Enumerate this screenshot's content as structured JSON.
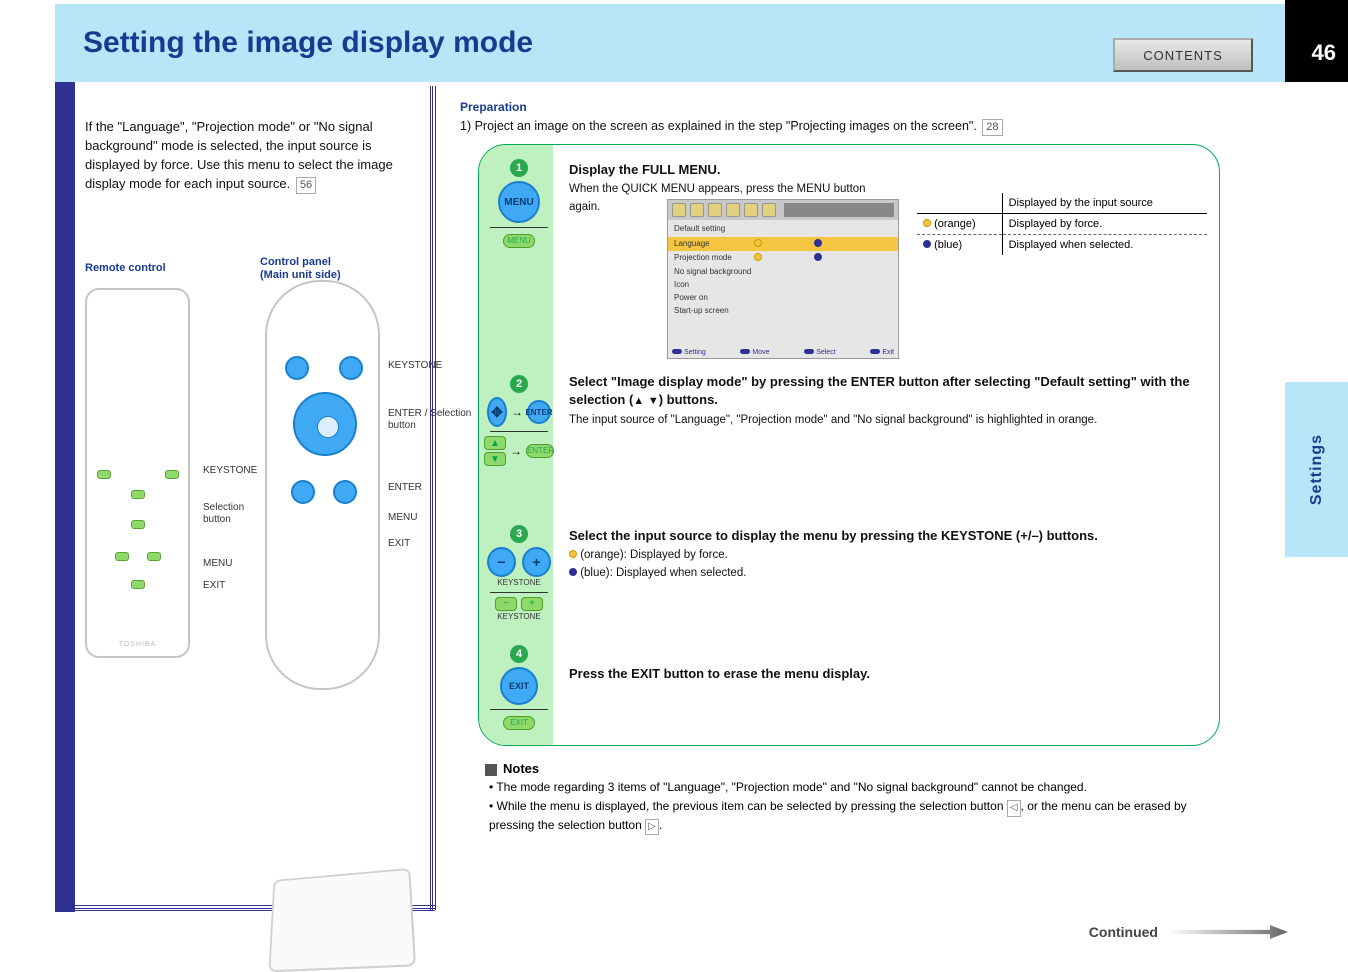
{
  "page_number": "46",
  "header": {
    "title": "Setting the image display mode",
    "contents_btn": "CONTENTS"
  },
  "side_tab": "Settings",
  "left": {
    "lead_1": "If the ",
    "lead_lang": "\"Language\"",
    "lead_2": ", ",
    "lead_ptype": "\"Projection mode\"",
    "lead_3": " or ",
    "lead_nosig": "\"No signal background\"",
    "lead_4": " mode is selected, the input source is displayed by force. Use this menu to select the image display mode for each input source. ",
    "lead_ref": "56",
    "remote_label": "Remote control",
    "panel_label": "Control panel\n(Main unit side)",
    "callouts": {
      "keystone": "KEYSTONE",
      "selection": "Selection\nbutton",
      "menu": "MENU",
      "enter": "ENTER / Selection\nbutton",
      "exit": "EXIT",
      "enter2": "ENTER",
      "keystone2": "KEYSTONE",
      "menu2": "MENU",
      "exit2": "EXIT"
    }
  },
  "right": {
    "prep_label": "Preparation",
    "prep_1": "1) Project an image on the screen as explained in the step \"Projecting images on the screen\". ",
    "prep_ref": "28",
    "steps": {
      "s1_title": "Display the FULL MENU.",
      "s1_sub": "When the QUICK MENU appears, press the MENU button again.",
      "s2_title": "Select \"Image display mode\" by pressing the ENTER button after selecting \"Default setting\" with the selection (     ) buttons.",
      "s2_sub": "The input source of \"Language\", \"Projection mode\" and \"No signal background\" is highlighted in orange.",
      "s3_title": "Select the input source to display the menu by pressing the KEYSTONE (+/–) buttons.",
      "s3_sub_a": ": Displayed by force.",
      "s3_sub_b": ": Displayed when selected.",
      "s4_title": "Press the EXIT button to erase the menu display.",
      "btn_menu": "MENU",
      "btn_enter": "ENTER",
      "btn_exit": "EXIT",
      "btn_keystone": "KEYSTONE"
    },
    "osd": {
      "category": "Default setting",
      "rows": [
        {
          "name": "Language",
          "force": true,
          "select": true
        },
        {
          "name": "Projection mode",
          "force": true,
          "select": true
        },
        {
          "name": "No signal background",
          "force": false,
          "select": false
        },
        {
          "name": "Icon",
          "force": false,
          "select": false
        },
        {
          "name": "Power on",
          "force": false,
          "select": false
        },
        {
          "name": "Start-up screen",
          "force": false,
          "select": false
        }
      ],
      "bottom": [
        "Setting",
        "Move",
        "Select",
        "Exit"
      ]
    },
    "table": {
      "head": [
        "",
        "Displayed by the input source"
      ],
      "row1": [
        "(orange)",
        "Displayed by force."
      ],
      "row2": [
        "(blue)",
        "Displayed when selected."
      ]
    }
  },
  "notes": {
    "title": "Notes",
    "n1": "• The mode regarding 3 items of \"Language\", \"Projection mode\" and \"No signal background\" cannot be changed.",
    "n2_a": "• While the menu is displayed, the previous item can be selected by pressing the selection button ",
    "n2_b": ", or the menu can be erased by pressing the selection button ",
    "n2_c": "."
  },
  "continued": "Continued"
}
